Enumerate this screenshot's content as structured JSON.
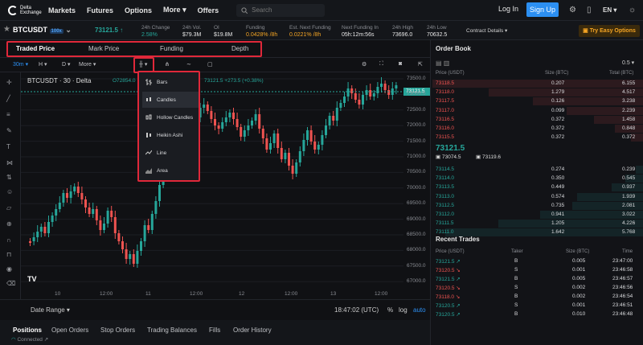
{
  "header": {
    "logo_line1": "Delta",
    "logo_line2": "Exchange",
    "nav": [
      "Markets",
      "Futures",
      "Options",
      "More",
      "Offers"
    ],
    "search_placeholder": "Search",
    "login": "Log In",
    "signup": "Sign Up",
    "lang": "EN"
  },
  "ticker": {
    "symbol": "BTCUSDT",
    "leverage": "100x",
    "price": "73121.5",
    "stats": [
      {
        "label": "24h Change",
        "value": "2.58%"
      },
      {
        "label": "24h Vol.",
        "value": "$79.3M"
      },
      {
        "label": "OI",
        "value": "$19.8M"
      },
      {
        "label": "Funding",
        "value": "0.0428% /8h"
      },
      {
        "label": "Est. Next Funding",
        "value": "0.0221% /8h"
      },
      {
        "label": "Next Funding In",
        "value": "05h:12m:56s"
      },
      {
        "label": "24h High",
        "value": "73696.0"
      },
      {
        "label": "24h Low",
        "value": "70632.5"
      }
    ],
    "contract_details": "Contract Details",
    "easy_options": "Try Easy Options"
  },
  "chart_tabs": [
    "Traded Price",
    "Mark Price",
    "Funding",
    "Depth"
  ],
  "toolbar": {
    "interval": "30m",
    "h": "H",
    "d": "D",
    "more": "More"
  },
  "chart": {
    "title": "BTCUSDT",
    "interval": "30",
    "source": "Delta",
    "open_label": "O72854.0",
    "change": "73121.5 +273.5 (+0.38%)",
    "y_labels": [
      "73500.0",
      "73000.0",
      "72500.0",
      "72000.0",
      "71500.0",
      "71000.0",
      "70500.0",
      "70000.0",
      "69500.0",
      "69000.0",
      "68500.0",
      "68000.0",
      "67500.0",
      "67000.0"
    ],
    "price_tag": "73121.5",
    "x_labels": [
      "10",
      "12:00",
      "11",
      "12:00",
      "12",
      "12:00",
      "13",
      "12:00"
    ],
    "date_range": "Date Range",
    "time": "18:47:02 (UTC)",
    "pct": "%",
    "log": "log",
    "auto": "auto"
  },
  "chart_type_menu": {
    "items": [
      "Bars",
      "Candles",
      "Hollow Candles",
      "Heikin Ashi",
      "Line",
      "Area"
    ],
    "selected": "Candles"
  },
  "order_book": {
    "title": "Order Book",
    "step": "0.5",
    "cols": [
      "Price (USDT)",
      "Size (BTC)",
      "Total (BTC)"
    ],
    "asks": [
      [
        "73118.5",
        "0.207",
        "6.155"
      ],
      [
        "73118.0",
        "1.279",
        "4.517"
      ],
      [
        "73117.5",
        "0.126",
        "3.238"
      ],
      [
        "73117.0",
        "0.099",
        "2.239"
      ],
      [
        "73116.5",
        "0.372",
        "1.458"
      ],
      [
        "73116.0",
        "0.372",
        "0.848"
      ],
      [
        "73115.5",
        "0.372",
        "0.372"
      ]
    ],
    "mid_price": "73121.5",
    "mark": "73074.5",
    "index": "73119.6",
    "bids": [
      [
        "73114.5",
        "0.274",
        "0.239"
      ],
      [
        "73114.0",
        "0.350",
        "0.545"
      ],
      [
        "73113.5",
        "0.449",
        "0.937"
      ],
      [
        "73113.0",
        "0.574",
        "1.939"
      ],
      [
        "73112.5",
        "0.735",
        "2.081"
      ],
      [
        "73112.0",
        "0.941",
        "3.022"
      ],
      [
        "73111.5",
        "1.205",
        "4.226"
      ],
      [
        "73111.0",
        "1.642",
        "5.768"
      ]
    ]
  },
  "recent_trades": {
    "title": "Recent Trades",
    "cols": [
      "Price (USDT)",
      "Taker",
      "Size (BTC)",
      "Time"
    ],
    "rows": [
      [
        "73121.5",
        "B",
        "0.005",
        "23:47:00",
        "up"
      ],
      [
        "73120.5",
        "S",
        "0.001",
        "23:46:58",
        "down"
      ],
      [
        "73121.5",
        "B",
        "0.005",
        "23:46:57",
        "up"
      ],
      [
        "73120.5",
        "S",
        "0.002",
        "23:46:56",
        "down"
      ],
      [
        "73118.0",
        "B",
        "0.002",
        "23:46:54",
        "down"
      ],
      [
        "73120.5",
        "S",
        "0.001",
        "23:46:51",
        "up"
      ],
      [
        "73120.5",
        "B",
        "0.010",
        "23:46:48",
        "up"
      ]
    ]
  },
  "bottom_tabs": [
    "Positions",
    "Open Orders",
    "Stop Orders",
    "Trading Balances",
    "Fills",
    "Order History"
  ],
  "status": "Connected",
  "colors": {
    "up": "#26a69a",
    "down": "#ef5350",
    "accent": "#2c8ff2",
    "highlight": "#e0283a"
  }
}
